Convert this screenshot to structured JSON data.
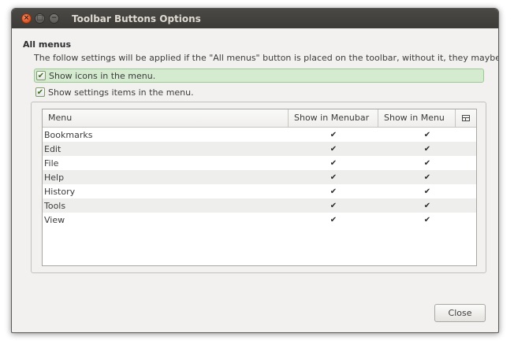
{
  "window": {
    "title": "Toolbar Buttons Options",
    "controls": {
      "close": "×",
      "maximize": "□",
      "minimize": "−"
    }
  },
  "section": {
    "title": "All menus",
    "description": "The follow settings will be applied if the \"All menus\" button is placed on the toolbar, without it, they maybe ignored."
  },
  "options": {
    "show_icons": {
      "label": "Show icons in the menu.",
      "checked": true
    },
    "show_settings": {
      "label": "Show settings items in the menu.",
      "checked": true
    }
  },
  "table": {
    "columns": [
      "Menu",
      "Show in Menubar",
      "Show in Menu"
    ],
    "column_picker_icon": "columns-icon",
    "rows": [
      {
        "name": "Bookmarks",
        "menubar": "✔",
        "menu": "✔"
      },
      {
        "name": "Edit",
        "menubar": "✔",
        "menu": "✔"
      },
      {
        "name": "File",
        "menubar": "✔",
        "menu": "✔"
      },
      {
        "name": "Help",
        "menubar": "✔",
        "menu": "✔"
      },
      {
        "name": "History",
        "menubar": "✔",
        "menu": "✔"
      },
      {
        "name": "Tools",
        "menubar": "✔",
        "menu": "✔"
      },
      {
        "name": "View",
        "menubar": "✔",
        "menu": "✔"
      }
    ]
  },
  "buttons": {
    "close": "Close"
  },
  "colors": {
    "titlebar": "#3c3b37",
    "close_button": "#e05d2a",
    "highlight": "#d4ebd0",
    "checkbox": "#3b6f1f"
  }
}
